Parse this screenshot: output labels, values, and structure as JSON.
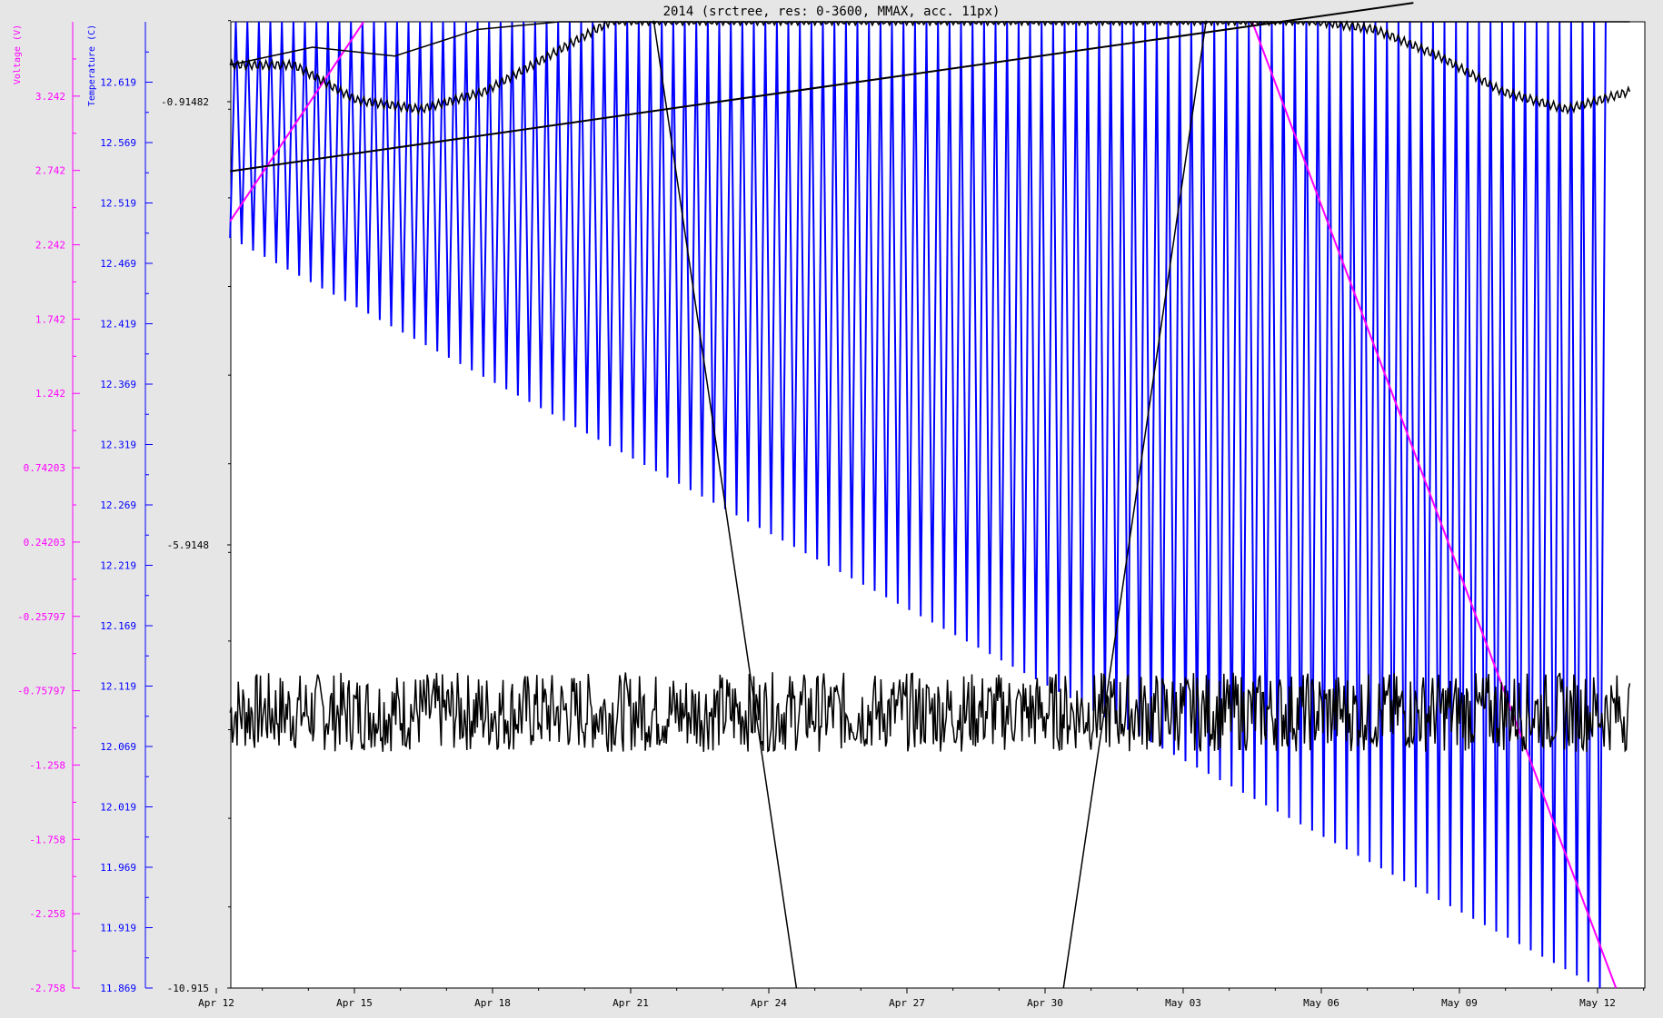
{
  "window": {
    "title": "2014 (srctree, res: 0-3600, MMAX, acc. 11px)"
  },
  "colors": {
    "background": "#e6e6e6",
    "plot_bg": "#ffffff",
    "voltage": "#ff00ff",
    "temperature": "#0000ff",
    "primary": "#000000"
  },
  "chart_data": {
    "type": "line",
    "title": "2014 (srctree, res: 0-3600, MMAX, acc. 11px)",
    "grid": false,
    "legend": "none",
    "x_range": [
      "2014-04-12",
      "2014-05-13"
    ],
    "x_ticks": [
      "Apr 12",
      "Apr 15",
      "Apr 18",
      "Apr 21",
      "Apr 24",
      "Apr 27",
      "Apr 30",
      "May 03",
      "May 06",
      "May 09",
      "May 12"
    ],
    "y_axes": [
      {
        "id": "voltage",
        "label": "Voltage (V)",
        "side": "left-outer",
        "range": [
          -2.758,
          3.742
        ],
        "ticks": [
          "3.242",
          "2.742",
          "2.242",
          "1.742",
          "1.242",
          "0.74203",
          "0.24203",
          "-0.25797",
          "-0.75797",
          "-1.258",
          "-1.758",
          "-2.258",
          "-2.758"
        ]
      },
      {
        "id": "temperature",
        "label": "Temperature (C)",
        "side": "left-middle",
        "range": [
          11.869,
          12.669
        ],
        "ticks": [
          "12.619",
          "12.569",
          "12.519",
          "12.469",
          "12.419",
          "12.369",
          "12.319",
          "12.269",
          "12.219",
          "12.169",
          "12.119",
          "12.069",
          "12.019",
          "11.969",
          "11.919",
          "11.869"
        ]
      },
      {
        "id": "primary",
        "label": "",
        "side": "left-inner",
        "range": [
          -10.915,
          0.0
        ],
        "ticks": [
          "-0.91482",
          "-5.9148",
          "-10.915"
        ]
      }
    ],
    "series": [
      {
        "axis": "voltage",
        "color": "#ff00ff",
        "kind": "line",
        "segments": [
          [
            [
              0.3,
              2.4
            ],
            [
              3.2,
              4.5
            ]
          ],
          [
            [
              22.5,
              4.8
            ],
            [
              30.4,
              -3.0
            ]
          ]
        ]
      },
      {
        "axis": "temperature",
        "color": "#0000ff",
        "kind": "oscillation",
        "period_days": 0.25,
        "envelope": {
          "top": 12.669,
          "bottom_start": 12.49,
          "bottom_end": 11.872,
          "end_day": 29.9
        }
      },
      {
        "axis": "primary",
        "color": "#000000",
        "kind": "noisy_sine",
        "values": [
          -0.5,
          -0.5,
          -0.9,
          -1.0,
          -0.8,
          -0.4,
          0.0,
          0.0,
          0.0,
          0.0,
          0.0,
          0.0,
          0.0,
          0.0,
          0.0,
          0.0,
          0.0,
          0.0,
          -0.1,
          -0.4,
          -0.8,
          -1.0,
          -0.8
        ]
      },
      {
        "axis": "primary",
        "color": "#000000",
        "kind": "smooth_curve",
        "values": [
          -0.5,
          -0.3,
          -0.4,
          -0.1,
          0.2,
          0.5,
          0.8,
          1.2,
          2.0,
          3.0,
          4.0,
          5.3,
          6.6,
          7.6,
          8.5,
          9.2,
          9.8,
          10.3
        ]
      },
      {
        "axis": "primary",
        "color": "#000000",
        "kind": "line",
        "values": [
          [
            0.3,
            -1.7
          ],
          [
            26.0,
            0.2
          ]
        ]
      },
      {
        "axis": "primary",
        "color": "#000000",
        "kind": "noise_band",
        "center": -7.8,
        "amplitude": 0.45
      },
      {
        "axis": "primary",
        "color": "#000000",
        "kind": "steep_curves",
        "values": [
          [
            9.5,
            0.0
          ],
          [
            12.6,
            -10.915
          ],
          [
            18.4,
            -10.915
          ],
          [
            21.5,
            0.0
          ]
        ]
      }
    ]
  }
}
